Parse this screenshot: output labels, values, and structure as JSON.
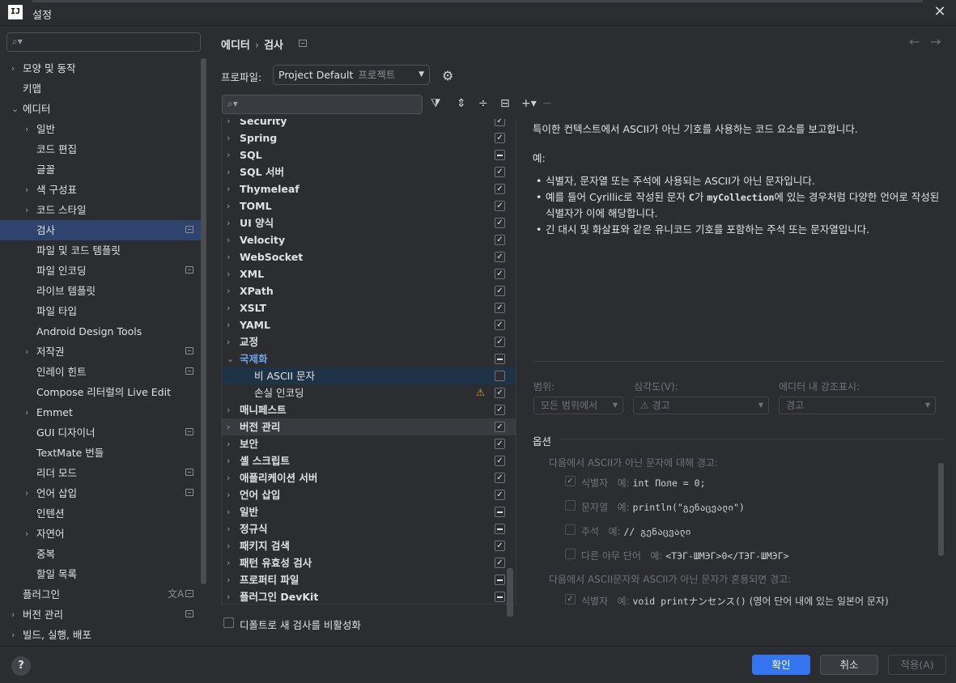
{
  "window": {
    "title": "설정",
    "app_icon": "IJ"
  },
  "sidebar": {
    "items": [
      {
        "label": "모양 및 동작",
        "arrow": "›",
        "badge": false
      },
      {
        "label": "키맵",
        "arrow": "",
        "badge": false
      },
      {
        "label": "에디터",
        "arrow": "⌄",
        "badge": false
      },
      {
        "label": "일반",
        "arrow": "›",
        "badge": false
      },
      {
        "label": "코드 편집",
        "arrow": "",
        "badge": false
      },
      {
        "label": "글꼴",
        "arrow": "",
        "badge": false
      },
      {
        "label": "색 구성표",
        "arrow": "›",
        "badge": false
      },
      {
        "label": "코드 스타일",
        "arrow": "›",
        "badge": false
      },
      {
        "label": "검사",
        "arrow": "",
        "badge": true,
        "selected": true
      },
      {
        "label": "파일 및 코드 템플릿",
        "arrow": "",
        "badge": false
      },
      {
        "label": "파일 인코딩",
        "arrow": "",
        "badge": true
      },
      {
        "label": "라이브 템플릿",
        "arrow": "",
        "badge": false
      },
      {
        "label": "파일 타입",
        "arrow": "",
        "badge": false
      },
      {
        "label": "Android Design Tools",
        "arrow": "",
        "badge": false
      },
      {
        "label": "저작권",
        "arrow": "›",
        "badge": true
      },
      {
        "label": "인레이 힌트",
        "arrow": "",
        "badge": true
      },
      {
        "label": "Compose 리터럴의 Live Edit",
        "arrow": "",
        "badge": false
      },
      {
        "label": "Emmet",
        "arrow": "›",
        "badge": false
      },
      {
        "label": "GUI 디자이너",
        "arrow": "",
        "badge": true
      },
      {
        "label": "TextMate 번들",
        "arrow": "",
        "badge": false
      },
      {
        "label": "리더 모드",
        "arrow": "",
        "badge": true
      },
      {
        "label": "언어 삽입",
        "arrow": "›",
        "badge": true
      },
      {
        "label": "인텐션",
        "arrow": "",
        "badge": false
      },
      {
        "label": "자연어",
        "arrow": "›",
        "badge": false
      },
      {
        "label": "중복",
        "arrow": "",
        "badge": false
      },
      {
        "label": "할일 목록",
        "arrow": "",
        "badge": false
      },
      {
        "label": "플러그인",
        "arrow": "",
        "badge": true,
        "translate": "文A"
      },
      {
        "label": "버전 관리",
        "arrow": "›",
        "badge": true
      },
      {
        "label": "빌드, 실행, 배포",
        "arrow": "›",
        "badge": false
      }
    ]
  },
  "header": {
    "crumb1": "에디터",
    "sep": "›",
    "crumb2": "검사"
  },
  "profile": {
    "label": "프로파일:",
    "value": "Project Default",
    "sub": "프로젝트"
  },
  "inspections": {
    "rows": [
      {
        "label": "Security",
        "state": "check"
      },
      {
        "label": "Spring",
        "state": "check"
      },
      {
        "label": "SQL",
        "state": "dash"
      },
      {
        "label": "SQL 서버",
        "state": "check"
      },
      {
        "label": "Thymeleaf",
        "state": "check"
      },
      {
        "label": "TOML",
        "state": "check"
      },
      {
        "label": "UI 양식",
        "state": "check"
      },
      {
        "label": "Velocity",
        "state": "check"
      },
      {
        "label": "WebSocket",
        "state": "check"
      },
      {
        "label": "XML",
        "state": "check"
      },
      {
        "label": "XPath",
        "state": "check"
      },
      {
        "label": "XSLT",
        "state": "check"
      },
      {
        "label": "YAML",
        "state": "check"
      },
      {
        "label": "교정",
        "state": "check"
      },
      {
        "label": "국제화",
        "state": "dash",
        "expanded": true
      },
      {
        "label": "비 ASCII 문자",
        "state": "empty",
        "child": true,
        "selected": true
      },
      {
        "label": "손실 인코딩",
        "state": "check",
        "child": true,
        "warn": true
      },
      {
        "label": "매니페스트",
        "state": "check"
      },
      {
        "label": "버전 관리",
        "state": "check",
        "hover": true
      },
      {
        "label": "보안",
        "state": "check"
      },
      {
        "label": "셸 스크립트",
        "state": "check"
      },
      {
        "label": "애플리케이션 서버",
        "state": "check"
      },
      {
        "label": "언어 삽입",
        "state": "check"
      },
      {
        "label": "일반",
        "state": "dash"
      },
      {
        "label": "정규식",
        "state": "dash"
      },
      {
        "label": "패키지 검색",
        "state": "check"
      },
      {
        "label": "패턴 유효성 검사",
        "state": "check"
      },
      {
        "label": "프로퍼티 파일",
        "state": "dash"
      },
      {
        "label": "플러그인 DevKit",
        "state": "dash"
      }
    ],
    "default_disable": "디폴트로 새 검사를 비활성화"
  },
  "description": {
    "summary": "특이한 컨텍스트에서 ASCII가 아닌 기호를 사용하는 코드 요소를 보고합니다.",
    "example_label": "예:",
    "bullet1": "식별자, 문자열 또는 주석에 사용되는 ASCII가 아닌 문자입니다.",
    "bullet2a": "예를 들어 Cyrillic로 작성된 문자 ",
    "bullet2_code1": "C",
    "bullet2b": "가 ",
    "bullet2_code2": "myCollection",
    "bullet2c": "에 있는 경우처럼 다양한 언어로 작성된 식별자가 이에 해당합니다.",
    "bullet3": "긴 대시 및 화살표와 같은 유니코드 기호를 포함하는 주석 또는 문자열입니다."
  },
  "filters": {
    "scope_label": "범위:",
    "scope_value": "모든 범위에서",
    "severity_label": "심각도(V):",
    "severity_value": "경고",
    "highlight_label": "에디터 내 강조표시:",
    "highlight_value": "경고"
  },
  "options": {
    "title": "옵션",
    "group1": "다음에서 ASCII가 아닌 문자에 대해 경고:",
    "o1_label": "식별자",
    "o1_example": "예:",
    "o1_code": "int Поле = 0;",
    "o2_label": "문자열",
    "o2_example": "예:",
    "o2_code": "println(\"გენაცვალი\")",
    "o3_label": "주석",
    "o3_example": "예:",
    "o3_code": "// გენაცვალი",
    "o4_label": "다른 아무 단어",
    "o4_example": "예:",
    "o4_code": "<ТЭГ-ШМЭГ>0</ТЭГ-ШМЭГ>",
    "group2": "다음에서 ASCII문자와 ASCII가 아닌 문자가 혼용되면 경고:",
    "o5_label": "식별자",
    "o5_example": "예:",
    "o5_code": "void printナンセンス()",
    "o5_note": "(영어 단어 내에 있는 일본어 문자)"
  },
  "footer": {
    "help": "?",
    "ok": "확인",
    "cancel": "취소",
    "apply": "적용(A)"
  }
}
